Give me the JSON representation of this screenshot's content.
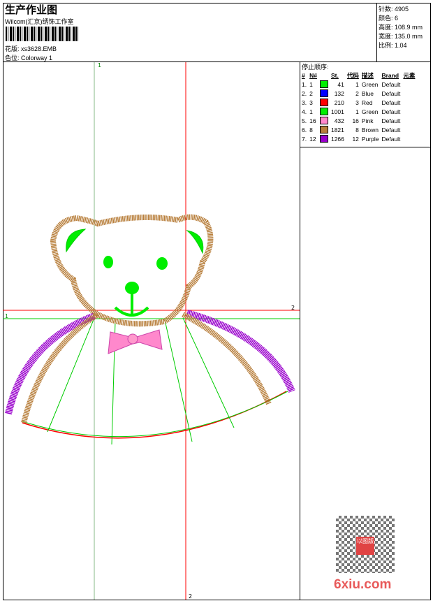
{
  "header": {
    "title": "生产作业图",
    "company": "Wilcom(汇京)绣饰工作室",
    "design_label": "花版:",
    "design_value": "xs3628.EMB",
    "colorway_label": "色位:",
    "colorway_value": "Colorway 1"
  },
  "stats": [
    {
      "label": "针数:",
      "value": "4905"
    },
    {
      "label": "颜色:",
      "value": "6"
    },
    {
      "label": "高度:",
      "value": "108.9 mm"
    },
    {
      "label": "宽度:",
      "value": "135.0 mm"
    },
    {
      "label": "比例:",
      "value": "1.04"
    }
  ],
  "stop_sequence": {
    "title": "停止顺序:",
    "columns": [
      "#",
      "N#",
      "",
      "St.",
      "代码",
      "描述",
      "Brand",
      "元素"
    ],
    "rows": [
      {
        "idx": "1.",
        "n": "1",
        "color": "#00ee00",
        "st": "41",
        "code": "1",
        "desc": "Green",
        "brand": "Default"
      },
      {
        "idx": "2.",
        "n": "2",
        "color": "#0000ff",
        "st": "132",
        "code": "2",
        "desc": "Blue",
        "brand": "Default"
      },
      {
        "idx": "3.",
        "n": "3",
        "color": "#ff0000",
        "st": "210",
        "code": "3",
        "desc": "Red",
        "brand": "Default"
      },
      {
        "idx": "4.",
        "n": "1",
        "color": "#00ee00",
        "st": "1001",
        "code": "1",
        "desc": "Green",
        "brand": "Default"
      },
      {
        "idx": "5.",
        "n": "16",
        "color": "#ff88cc",
        "st": "432",
        "code": "16",
        "desc": "Pink",
        "brand": "Default"
      },
      {
        "idx": "6.",
        "n": "8",
        "color": "#b87f3c",
        "st": "1821",
        "code": "8",
        "desc": "Brown",
        "brand": "Default"
      },
      {
        "idx": "7.",
        "n": "12",
        "color": "#9900cc",
        "st": "1266",
        "code": "12",
        "desc": "Purple",
        "brand": "Default"
      }
    ]
  },
  "guides": {
    "v1": "1",
    "h2": "2",
    "v2": "2",
    "h1": "1"
  },
  "watermark": {
    "text": "6xiu.com",
    "seal": "以图版"
  }
}
